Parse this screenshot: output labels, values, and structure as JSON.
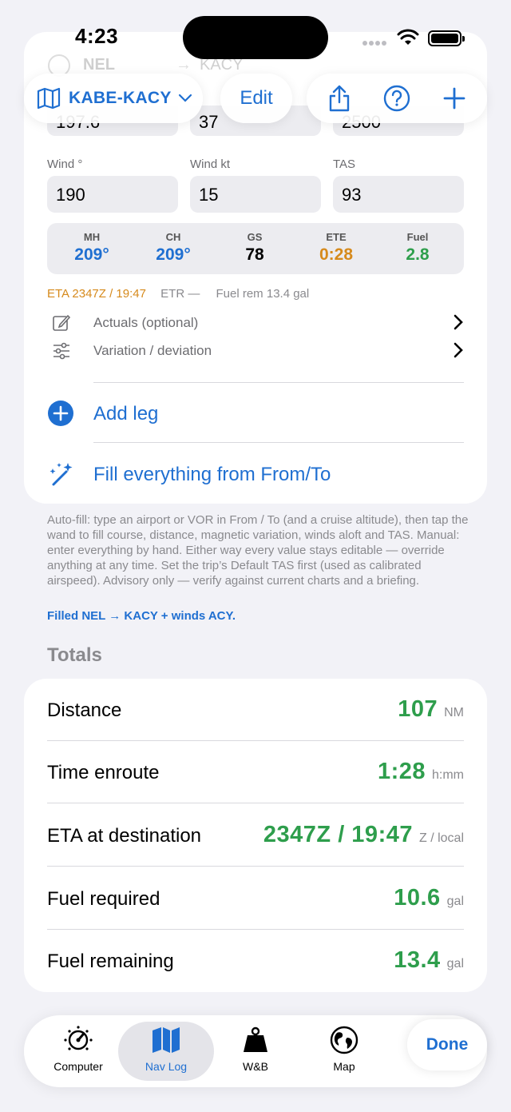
{
  "status": {
    "time": "4:23"
  },
  "ghost_row": {
    "from": "NEL",
    "to": "KACY"
  },
  "toolbar": {
    "route": "KABE-KACY",
    "edit": "Edit"
  },
  "fields_top": {
    "v1": "197.6",
    "v2": "37",
    "v3": "2500"
  },
  "fields": [
    {
      "label": "Wind °",
      "value": "190"
    },
    {
      "label": "Wind kt",
      "value": "15"
    },
    {
      "label": "TAS",
      "value": "93"
    }
  ],
  "calc": [
    {
      "key": "MH",
      "value": "209°",
      "color": "#1f6fd1"
    },
    {
      "key": "CH",
      "value": "209°",
      "color": "#1f6fd1"
    },
    {
      "key": "GS",
      "value": "78",
      "color": "#000000"
    },
    {
      "key": "ETE",
      "value": "0:28",
      "color": "#d68a1c"
    },
    {
      "key": "Fuel",
      "value": "2.8",
      "color": "#2e9e4c"
    }
  ],
  "eta": {
    "eta": "ETA 2347Z / 19:47",
    "etr": "ETR —",
    "fuel_rem": "Fuel rem 13.4 gal"
  },
  "options": {
    "actuals": "Actuals (optional)",
    "variation": "Variation / deviation"
  },
  "actions": {
    "add_leg": "Add leg",
    "fill": "Fill everything from From/To"
  },
  "note": "Auto-fill: type an airport or VOR in From / To (and a cruise altitude), then tap the wand to fill course, distance, magnetic variation, winds aloft and TAS. Manual: enter everything by hand. Either way every value stays editable — override anything at any time. Set the trip’s Default TAS first (used as calibrated airspeed). Advisory only — verify against current charts and a briefing.",
  "filled": "Filled NEL → KACY + winds ACY.",
  "totals": {
    "title": "Totals",
    "rows": [
      {
        "label": "Distance",
        "value": "107",
        "unit": "NM"
      },
      {
        "label": "Time enroute",
        "value": "1:28",
        "unit": "h:mm"
      },
      {
        "label": "ETA at destination",
        "value": "2347Z / 19:47",
        "unit": "Z / local"
      },
      {
        "label": "Fuel required",
        "value": "10.6",
        "unit": "gal"
      },
      {
        "label": "Fuel remaining",
        "value": "13.4",
        "unit": "gal"
      }
    ]
  },
  "tabs": [
    {
      "label": "Computer",
      "icon": "gauge-icon"
    },
    {
      "label": "Nav Log",
      "icon": "map-icon"
    },
    {
      "label": "W&B",
      "icon": "weight-icon"
    },
    {
      "label": "Map",
      "icon": "globe-icon"
    }
  ],
  "done": "Done",
  "colors": {
    "accent": "#1f6fd1",
    "green": "#2e9e4c",
    "orange": "#d68a1c"
  }
}
